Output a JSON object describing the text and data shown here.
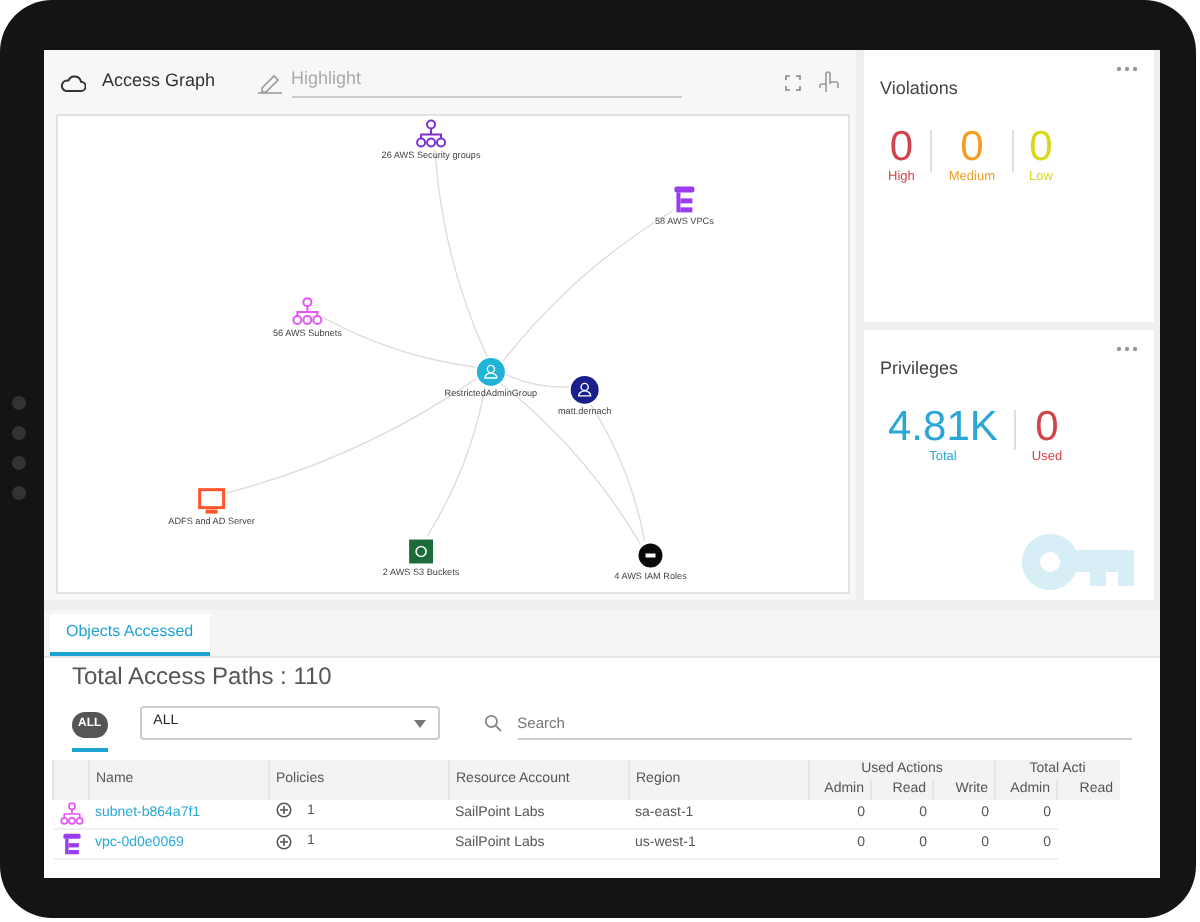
{
  "graph_panel": {
    "title": "Access Graph",
    "highlight_placeholder": "Highlight",
    "nodes": [
      {
        "label": "26 AWS Security groups",
        "kind": "group",
        "color": "#7b2fd6"
      },
      {
        "label": "58 AWS VPCs",
        "kind": "vpc",
        "color": "#9b3cf0"
      },
      {
        "label": "56 AWS Subnets",
        "kind": "group",
        "color": "#e455f5"
      },
      {
        "label": "RestrictedAdminGroup",
        "kind": "team",
        "color": "#1fb4d6"
      },
      {
        "label": "matt.dernach",
        "kind": "user",
        "color": "#1a1f8c"
      },
      {
        "label": "ADFS and AD Server",
        "kind": "server",
        "color": "#ff5528"
      },
      {
        "label": "2 AWS S3 Buckets",
        "kind": "bucket",
        "color": "#1e6b3a"
      },
      {
        "label": "4 AWS IAM Roles",
        "kind": "iam",
        "color": "#0a0a0a"
      }
    ]
  },
  "violations": {
    "title": "Violations",
    "counts": [
      {
        "value": "0",
        "label": "High",
        "color": "#d0454c"
      },
      {
        "value": "0",
        "label": "Medium",
        "color": "#f39c21"
      },
      {
        "value": "0",
        "label": "Low",
        "color": "#d8d81a"
      }
    ]
  },
  "privileges": {
    "title": "Privileges",
    "counts": [
      {
        "value": "4.81K",
        "label": "Total",
        "color": "#2aa7d6"
      },
      {
        "value": "0",
        "label": "Used",
        "color": "#d0454c"
      }
    ]
  },
  "objects": {
    "tabs": [
      {
        "label": "Objects Accessed",
        "selected": true
      }
    ],
    "total": "Total Access Paths : 110",
    "filter_chip": "ALL",
    "dropdown_value": "ALL",
    "search_placeholder": "Search",
    "table": {
      "columns": [
        "Name",
        "Policies",
        "Resource Account",
        "Region"
      ],
      "groups": [
        {
          "label": "Used Actions",
          "sub": [
            "Admin",
            "Read",
            "Write"
          ]
        },
        {
          "label": "Total Acti",
          "sub": [
            "Admin",
            "Read"
          ]
        }
      ],
      "rows": [
        {
          "kind": "group",
          "color": "#e455f5",
          "name": "subnet-b864a7f1",
          "policies": "1",
          "account": "SailPoint Labs",
          "region": "sa-east-1",
          "values": [
            "0",
            "0",
            "0",
            "0"
          ]
        },
        {
          "kind": "vpc",
          "color": "#9b3cf0",
          "name": "vpc-0d0e0069",
          "policies": "1",
          "account": "SailPoint Labs",
          "region": "us-west-1",
          "values": [
            "0",
            "0",
            "0",
            "0"
          ]
        }
      ]
    }
  }
}
